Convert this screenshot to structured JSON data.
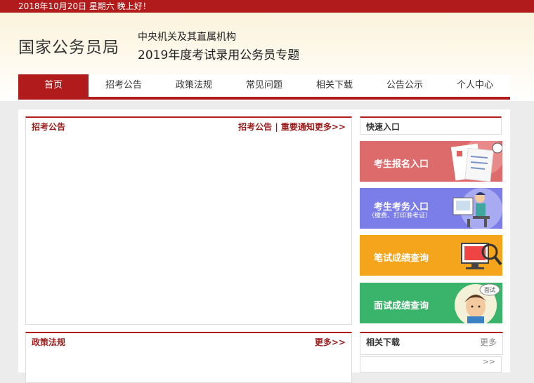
{
  "topbar": {
    "date_text": "2018年10月20日   星期六   晚上好！"
  },
  "header": {
    "logo": "国家公务员局",
    "subtitle1": "中央机关及其直属机构",
    "subtitle2": "2019年度考试录用公务员专题"
  },
  "nav": {
    "items": [
      "首页",
      "招考公告",
      "政策法规",
      "常见问题",
      "相关下载",
      "公告公示",
      "个人中心"
    ],
    "active": "首页"
  },
  "panels": {
    "recruit": {
      "title": "招考公告",
      "more": "招考公告 | 重要通知更多>>"
    },
    "policy": {
      "title": "政策法规",
      "more": "更多>>"
    },
    "quick": {
      "title": "快速入口"
    },
    "downloads": {
      "title": "相关下载",
      "more": "更多"
    }
  },
  "quick_entries": [
    {
      "label": "考生报名入口"
    },
    {
      "label": "考生考务入口",
      "sub": "（缴费、打印准考证）"
    },
    {
      "label": "笔试成绩查询"
    },
    {
      "label": "面试成绩查询",
      "tag": "面试"
    }
  ],
  "downloads_more_arrow": ">>",
  "colors": {
    "brand_red": "#b21b1b",
    "entry1": "#dd6b6b",
    "entry2": "#7b7ee8",
    "entry3": "#f4a51c",
    "entry4": "#3ab46a"
  }
}
